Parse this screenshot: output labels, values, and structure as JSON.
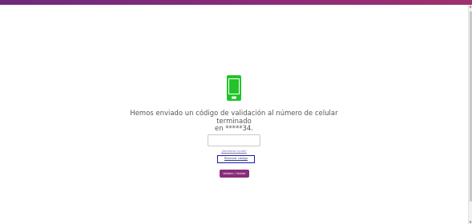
{
  "colors": {
    "brand": "#8a2a7a",
    "phone_icon": "#22c42a",
    "resend_outline": "#1a1aa6"
  },
  "verification": {
    "icon": "smartphone-icon",
    "message_line1": "Hemos enviado un código de validación al número de celular terminado",
    "message_line2": "en *****34.",
    "code_input_value": "",
    "code_input_placeholder": "",
    "help_link_label": "¿Necesitas ayuda?",
    "resend_link_label": "Reenviar código",
    "validate_button_label": "Validar / Volver"
  }
}
